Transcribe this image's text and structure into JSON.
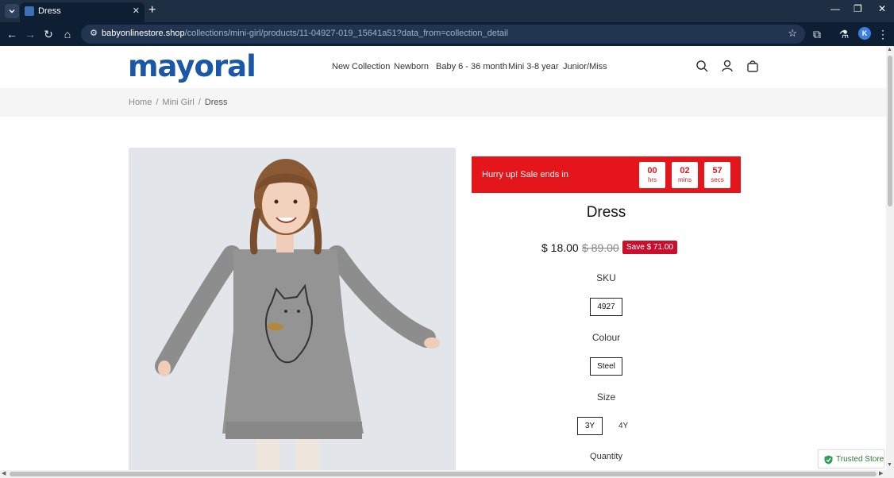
{
  "browser": {
    "tab_title": "Dress",
    "new_tab_glyph": "+",
    "url_host": "babyonlinestore.shop",
    "url_path": "/collections/mini-girl/products/11-04927-019_15641a51?data_from=collection_detail",
    "profile_initial": "K"
  },
  "site": {
    "logo": "mayoral",
    "nav": [
      "New Collection",
      "Newborn",
      "Baby 6 - 36 month",
      "Mini 3-8 year",
      "Junior/Miss"
    ]
  },
  "breadcrumb": [
    "Home",
    "Mini Girl",
    "Dress"
  ],
  "sale": {
    "text": "Hurry up!  Sale ends in",
    "timer": [
      {
        "value": "00",
        "unit": "hrs"
      },
      {
        "value": "02",
        "unit": "mins"
      },
      {
        "value": "57",
        "unit": "secs"
      }
    ]
  },
  "product": {
    "title": "Dress",
    "price": "$ 18.00",
    "compare_price": "$ 89.00",
    "save_badge": "Save $ 71.00",
    "sku_label": "SKU",
    "sku_value": "4927",
    "colour_label": "Colour",
    "colour_value": "Steel",
    "size_label": "Size",
    "sizes": [
      "3Y",
      "4Y"
    ],
    "quantity_label": "Quantity"
  },
  "trusted_badge": "Trusted Store",
  "colors": {
    "brand_blue": "#1a57a8",
    "sale_red": "#e5161b",
    "badge_red": "#c8102e",
    "browser_dark": "#0f1f33"
  }
}
